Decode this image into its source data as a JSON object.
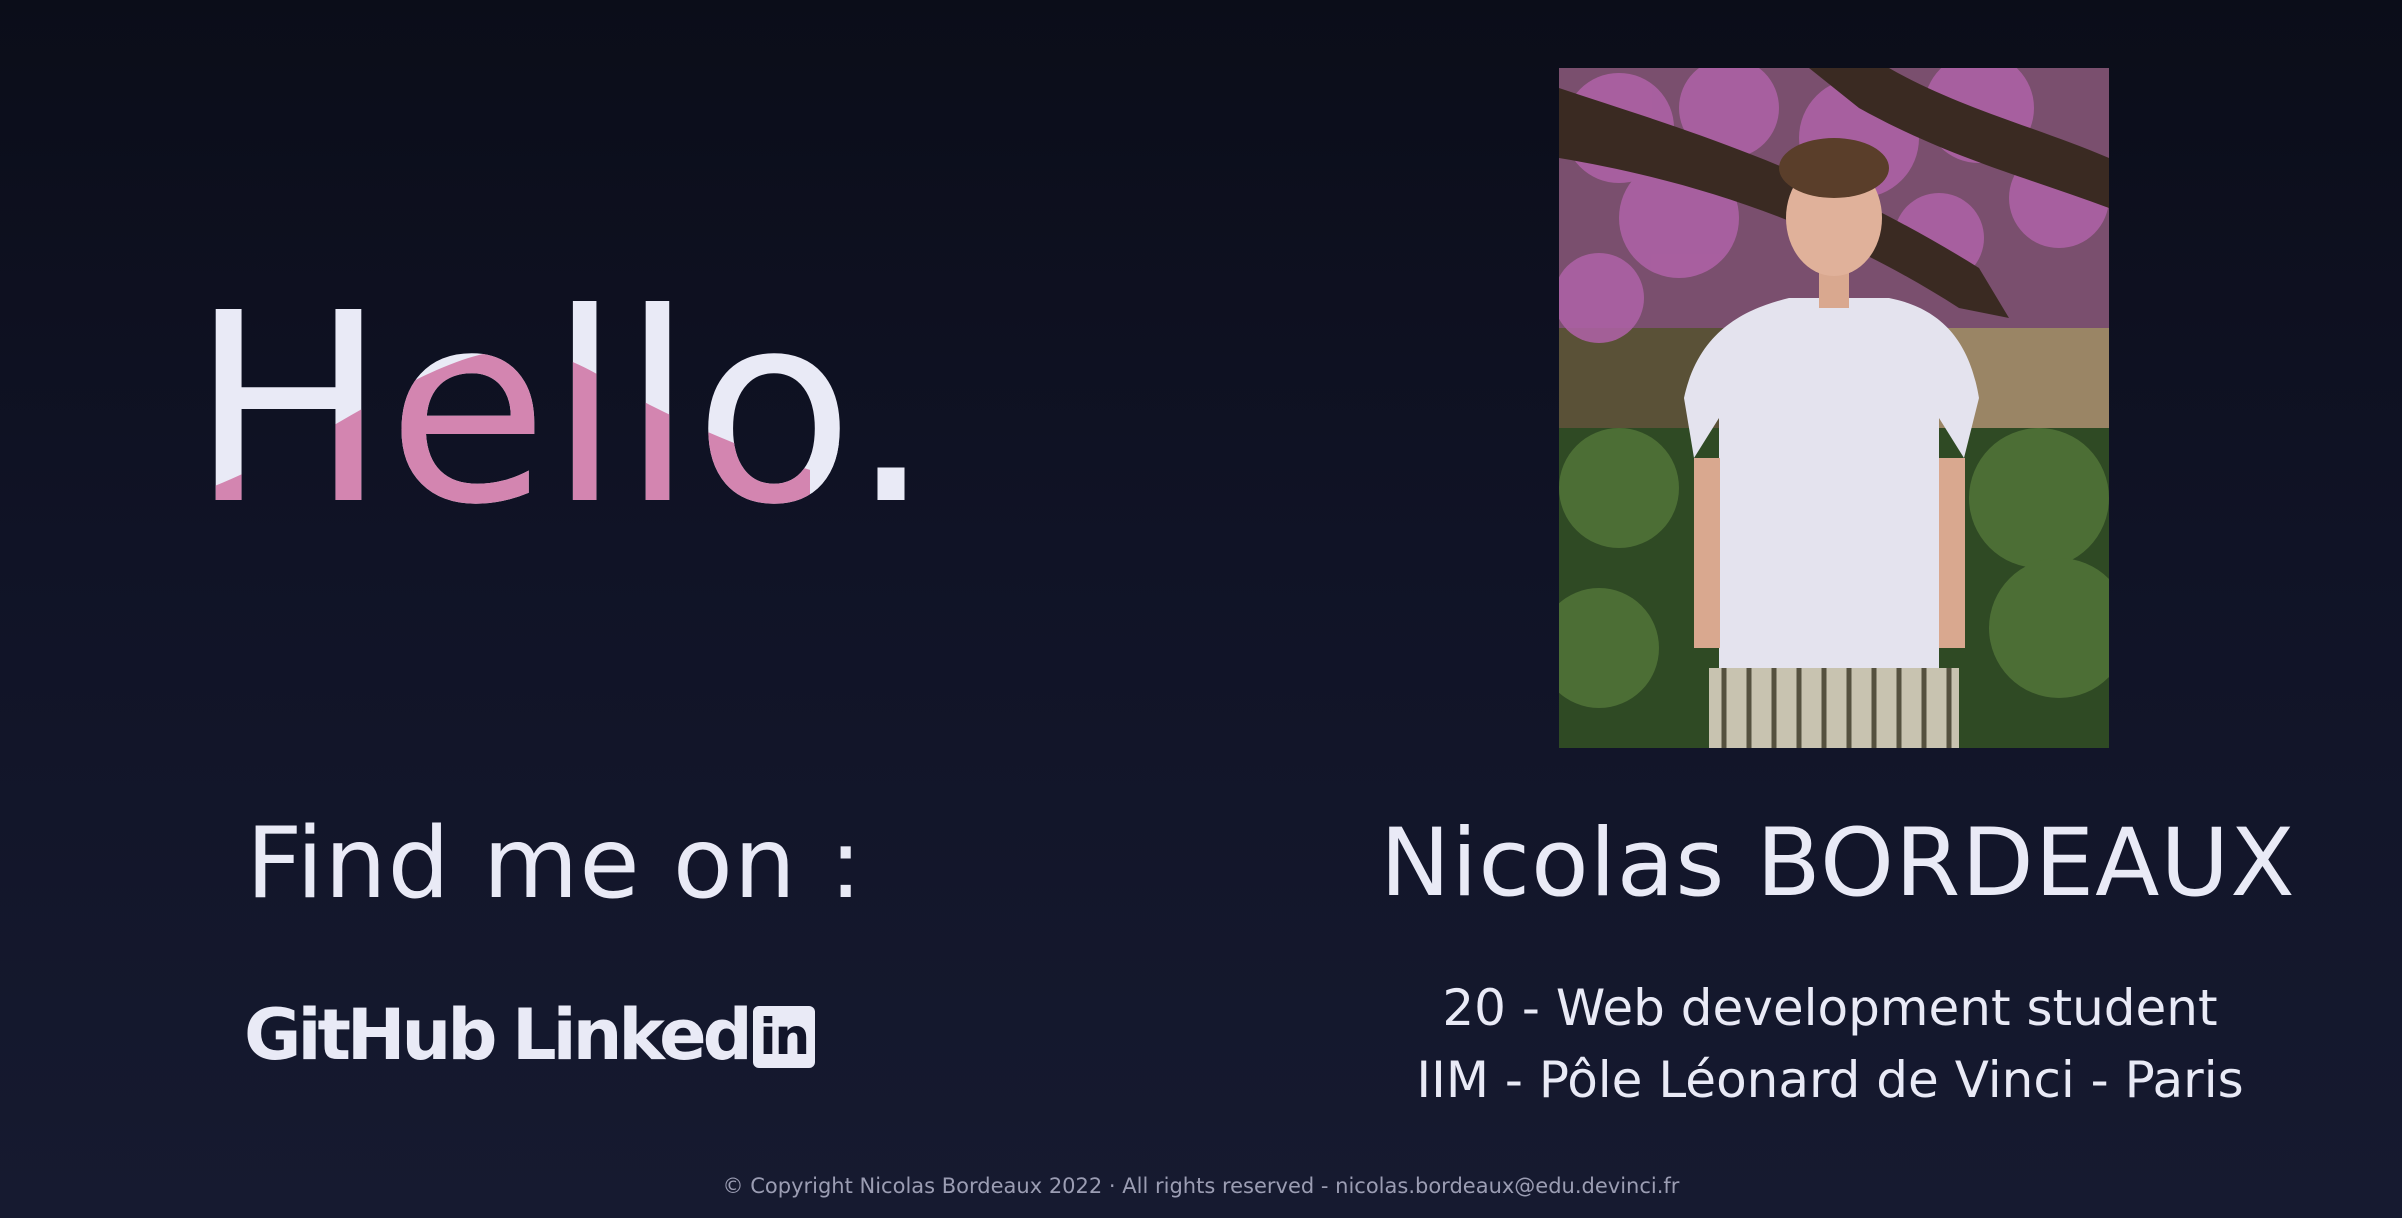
{
  "hero": {
    "greeting": "Hello."
  },
  "profile": {
    "photo_alt": "Nicolas Bordeaux portrait",
    "name": "Nicolas BORDEAUX",
    "line1": "20 - Web development student",
    "line2": "IIM - Pôle Léonard de Vinci - Paris"
  },
  "social": {
    "heading": "Find me on :",
    "github_label": "GitHub",
    "linkedin_label": "Linked",
    "linkedin_badge": "in"
  },
  "footer": {
    "text": "© Copyright Nicolas Bordeaux 2022 · All rights reserved - nicolas.bordeaux@edu.devinci.fr"
  },
  "colors": {
    "background": "#0b0d19",
    "text": "#e9eaf6",
    "accent_pink": "#d385b0"
  }
}
